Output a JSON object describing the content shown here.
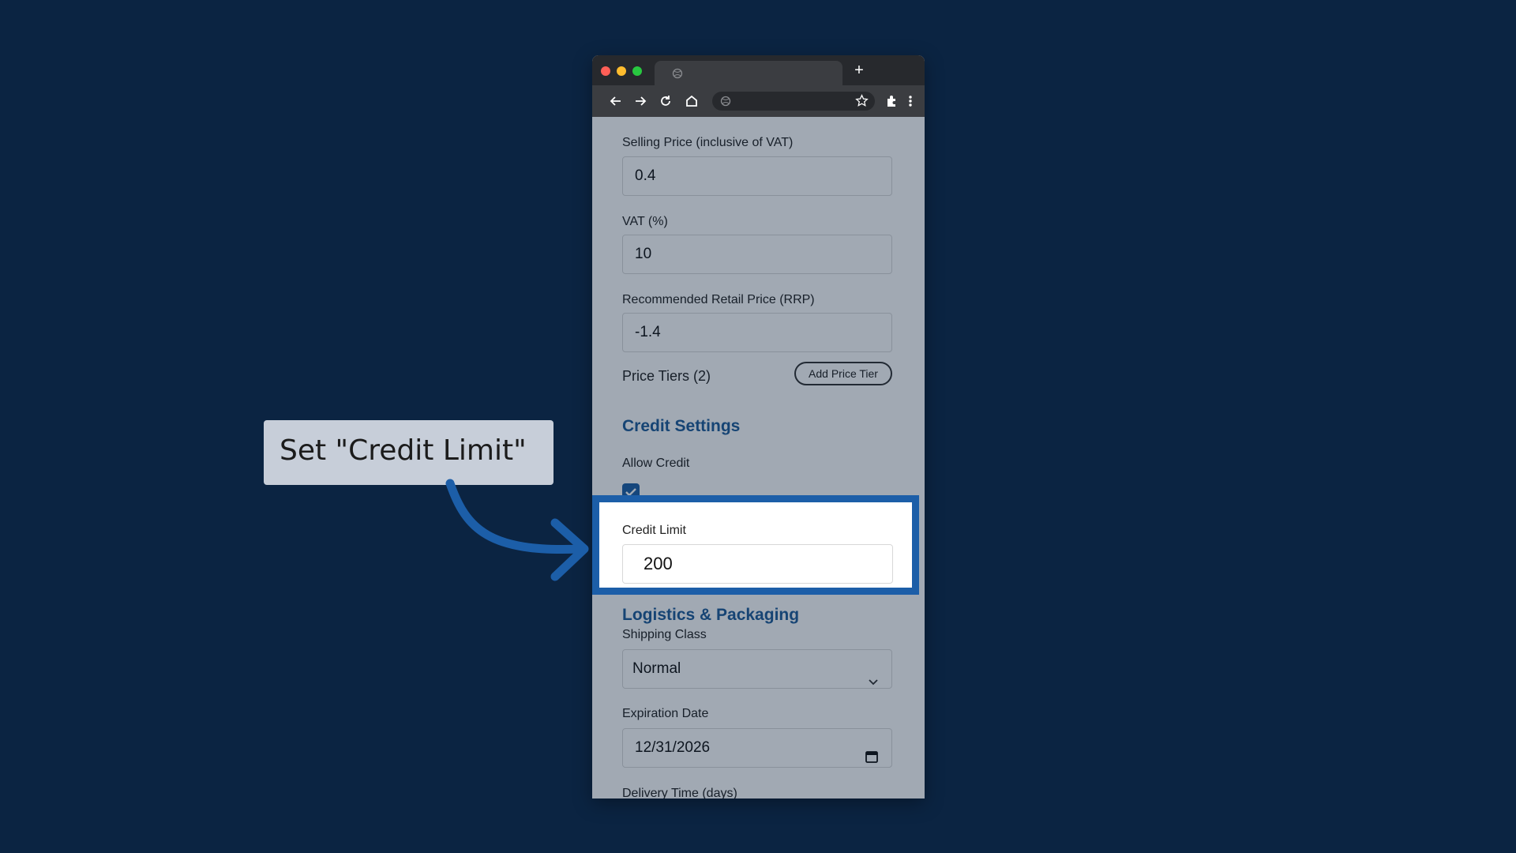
{
  "callout": {
    "text": "Set \"Credit Limit\""
  },
  "browser": {
    "toolbar_icons": [
      "back-icon",
      "forward-icon",
      "reload-icon",
      "home-icon",
      "star-icon",
      "extensions-icon",
      "menu-icon"
    ]
  },
  "form": {
    "selling_price": {
      "label": "Selling Price (inclusive of VAT)",
      "value": "0.4"
    },
    "vat": {
      "label": "VAT (%)",
      "value": "10"
    },
    "rrp": {
      "label": "Recommended Retail Price (RRP)",
      "value": "-1.4"
    },
    "price_tiers": {
      "label": "Price Tiers (2)",
      "button": "Add Price Tier"
    },
    "credit_settings": {
      "title": "Credit Settings",
      "allow_credit_label": "Allow Credit",
      "allow_credit_checked": true,
      "credit_limit": {
        "label": "Credit Limit",
        "value": "200"
      }
    },
    "logistics": {
      "title": "Logistics & Packaging",
      "shipping_class": {
        "label": "Shipping Class",
        "value": "Normal"
      },
      "expiration_date": {
        "label": "Expiration Date",
        "value": "12/31/2026"
      },
      "delivery_time": {
        "label": "Delivery Time (days)"
      }
    }
  },
  "colors": {
    "background": "#0b2442",
    "accent": "#1c5ea8",
    "section_title": "#1f5c99",
    "callout_bg": "#c7ced9"
  }
}
